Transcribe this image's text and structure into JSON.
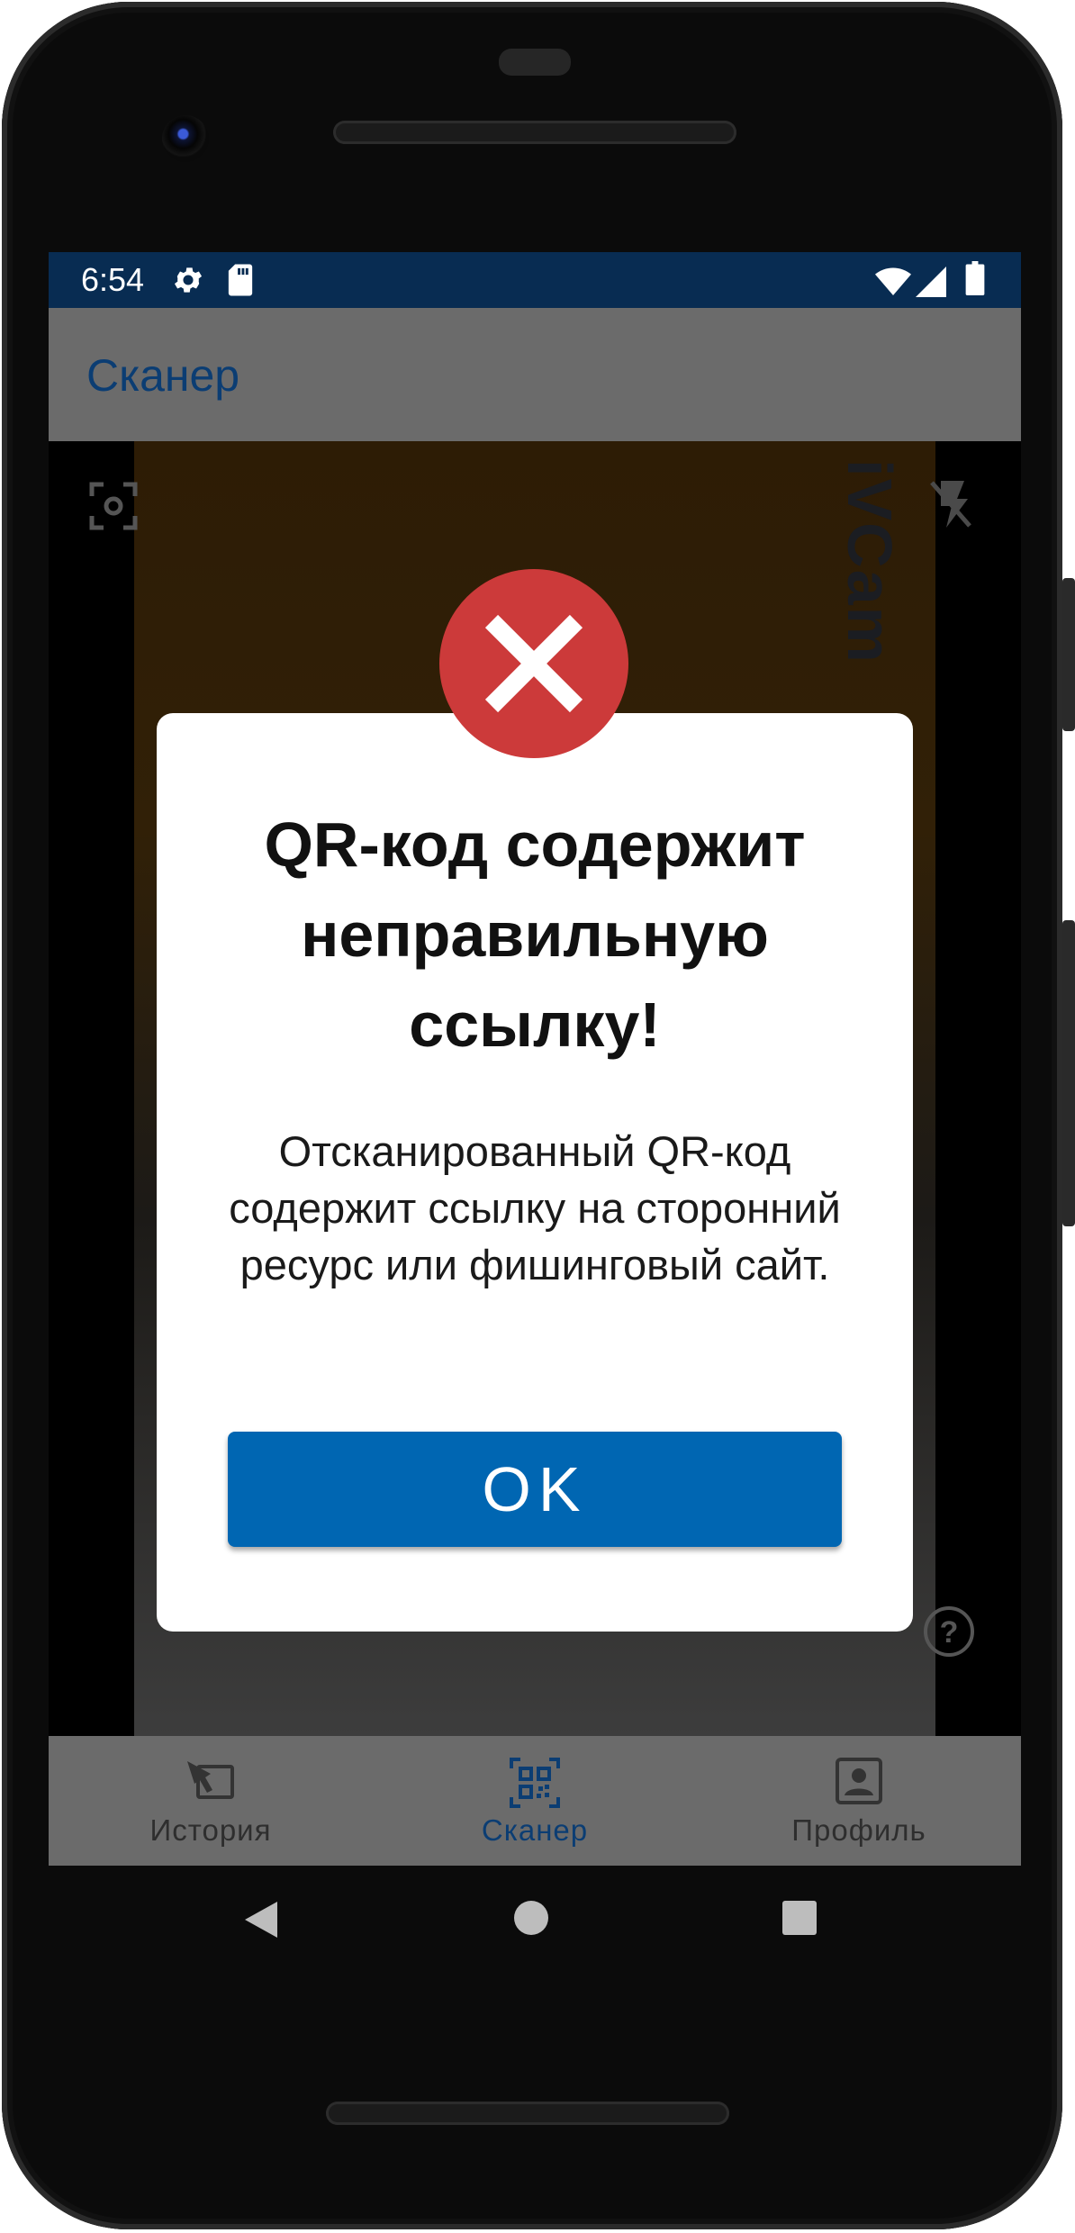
{
  "status_bar": {
    "time": "6:54",
    "icons": [
      "gear-icon",
      "sd-card-icon",
      "wifi-icon",
      "cell-signal-icon",
      "battery-icon"
    ]
  },
  "app_bar": {
    "title": "Сканер"
  },
  "camera": {
    "watermark": "iVCam"
  },
  "dialog": {
    "icon": "error-x-icon",
    "title": "QR-код содержит неправильную ссылку!",
    "message": "Отсканированный QR-код содержит ссылку на сторонний ресурс или фишинговый сайт.",
    "ok_label": "OK"
  },
  "bottom_nav": {
    "items": [
      {
        "label": "История",
        "icon": "history-icon",
        "active": false
      },
      {
        "label": "Сканер",
        "icon": "qr-scan-icon",
        "active": true
      },
      {
        "label": "Профиль",
        "icon": "profile-icon",
        "active": false
      }
    ]
  },
  "system_nav": [
    "back-icon",
    "home-icon",
    "recents-icon"
  ],
  "colors": {
    "status_bar": "#082c52",
    "accent": "#0b3d73",
    "button": "#0066b2",
    "error": "#cc3a3a",
    "overlay": "#6b6b6b"
  }
}
